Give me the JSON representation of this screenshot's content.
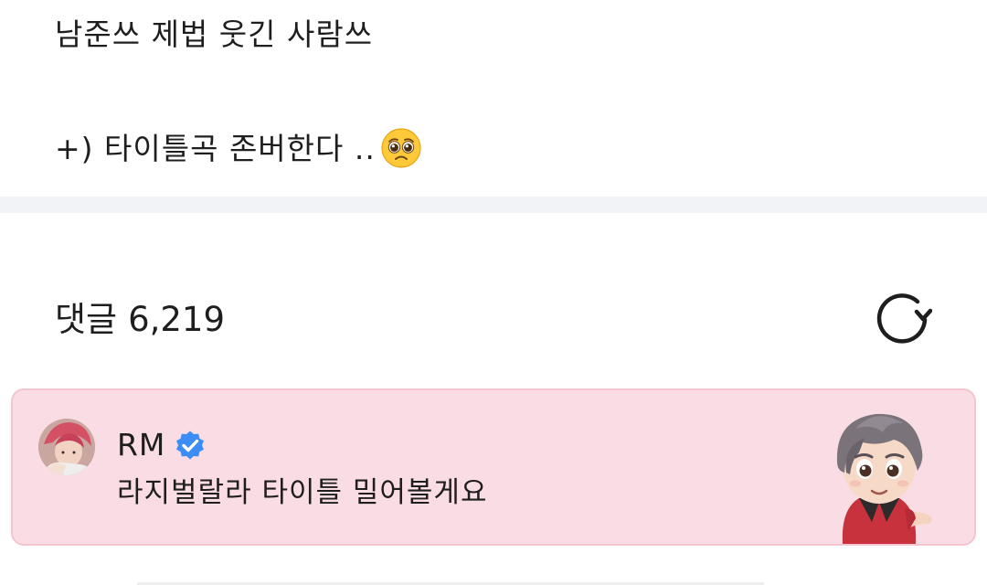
{
  "post": {
    "line1": "남준쓰 제법 웃긴 사람쓰",
    "line2": "+) 타이틀곡 존버한다 ..",
    "emoji": "pleading-face-icon"
  },
  "comments": {
    "label": "댓글",
    "count": "6,219",
    "refresh_icon": "refresh-icon"
  },
  "pinned_comment": {
    "author": "RM",
    "verified_icon": "verified-badge-icon",
    "text": "라지벌랄라 타이틀 밀어볼게요",
    "sticker": "character-sticker",
    "colors": {
      "background": "#fadde4",
      "border": "#f3c5cf",
      "verified": "#3c8ef5"
    }
  }
}
